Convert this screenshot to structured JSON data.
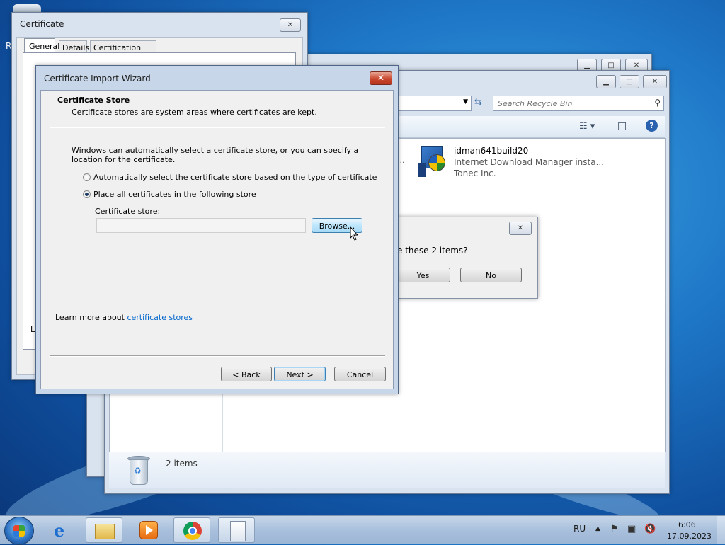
{
  "certificate_window": {
    "title": "Certificate",
    "tabs": [
      "General",
      "Details",
      "Certification Path"
    ],
    "close_label": "✕",
    "partial_text": "Le"
  },
  "explorer": {
    "search_placeholder": "Search Recycle Bin",
    "file": {
      "name": "idman641build20",
      "description": "Internet Download Manager insta...",
      "company": "Tonec Inc."
    },
    "status_count": "2 items",
    "partial_char": "R",
    "partial_ellipsis": "..."
  },
  "delete_dialog": {
    "question": "e these 2 items?",
    "yes_label": "Yes",
    "no_label": "No",
    "close_label": "✕"
  },
  "wizard": {
    "title": "Certificate Import Wizard",
    "header_title": "Certificate Store",
    "header_subtitle": "Certificate stores are system areas where certificates are kept.",
    "intro": "Windows can automatically select a certificate store, or you can specify a location for the certificate.",
    "option_auto": "Automatically select the certificate store based on the type of certificate",
    "option_manual": "Place all certificates in the following store",
    "store_label": "Certificate store:",
    "store_value": "",
    "browse_label": "Browse...",
    "learn_more_prefix": "Learn more about ",
    "learn_more_link": "certificate stores",
    "back_label": "< Back",
    "next_label": "Next >",
    "cancel_label": "Cancel",
    "close_label": "✕",
    "selected_option": "manual"
  },
  "taskbar": {
    "apps": [
      "start-orb",
      "internet-explorer",
      "windows-explorer",
      "media-player",
      "chrome",
      "document"
    ],
    "language": "RU",
    "time": "6:06",
    "date": "17.09.2023"
  },
  "colors": {
    "desktop": "#1f78c8",
    "link": "#0066cc",
    "close_red": "#c9472f"
  }
}
